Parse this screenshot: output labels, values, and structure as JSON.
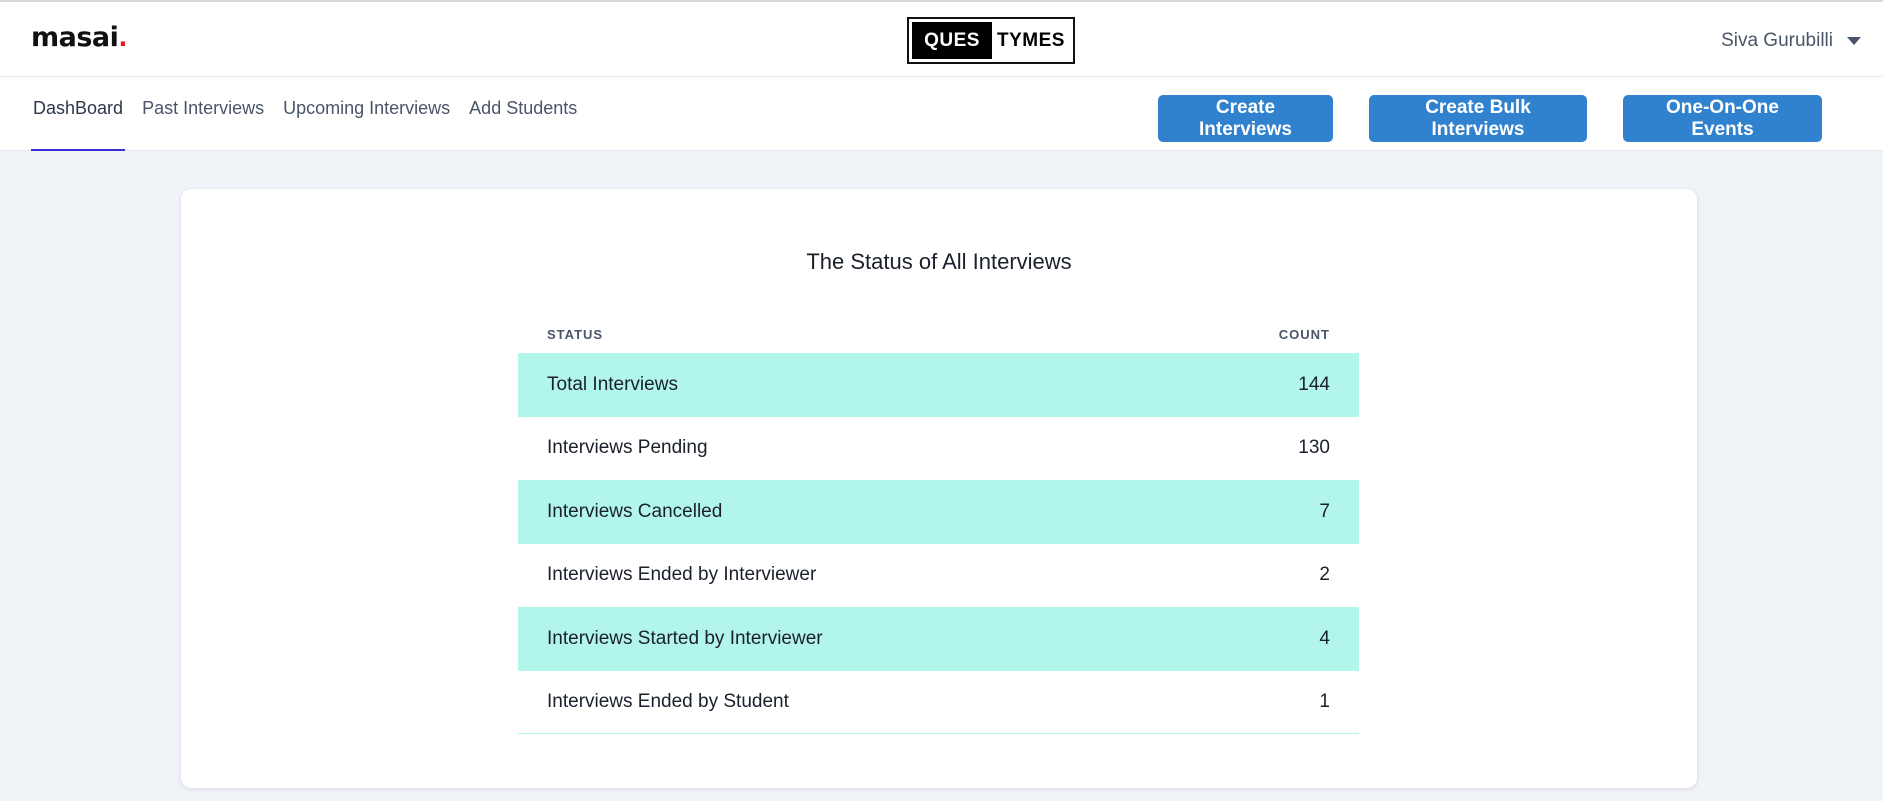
{
  "header": {
    "logo_text": "masai",
    "logo_dot": ".",
    "brand_left": "QUES",
    "brand_right": "TYMES",
    "user_name": "Siva Gurubilli"
  },
  "nav": {
    "tabs": [
      {
        "label": "DashBoard",
        "active": true
      },
      {
        "label": "Past Interviews",
        "active": false
      },
      {
        "label": "Upcoming Interviews",
        "active": false
      },
      {
        "label": "Add Students",
        "active": false
      }
    ],
    "buttons": {
      "create": "Create Interviews",
      "bulk": "Create Bulk Interviews",
      "one_on_one": "One-On-One Events"
    }
  },
  "card": {
    "title": "The Status of All Interviews",
    "columns": {
      "status": "STATUS",
      "count": "COUNT"
    },
    "rows": [
      {
        "status": "Total Interviews",
        "count": "144"
      },
      {
        "status": "Interviews Pending",
        "count": "130"
      },
      {
        "status": "Interviews Cancelled",
        "count": "7"
      },
      {
        "status": "Interviews Ended by Interviewer",
        "count": "2"
      },
      {
        "status": "Interviews Started by Interviewer",
        "count": "4"
      },
      {
        "status": "Interviews Ended by Student",
        "count": "1"
      }
    ]
  },
  "colors": {
    "accent_blue": "#3182ce",
    "row_highlight": "#b2f5ea",
    "active_tab_underline": "#3b2fd6",
    "logo_dot": "#e11d2a"
  }
}
